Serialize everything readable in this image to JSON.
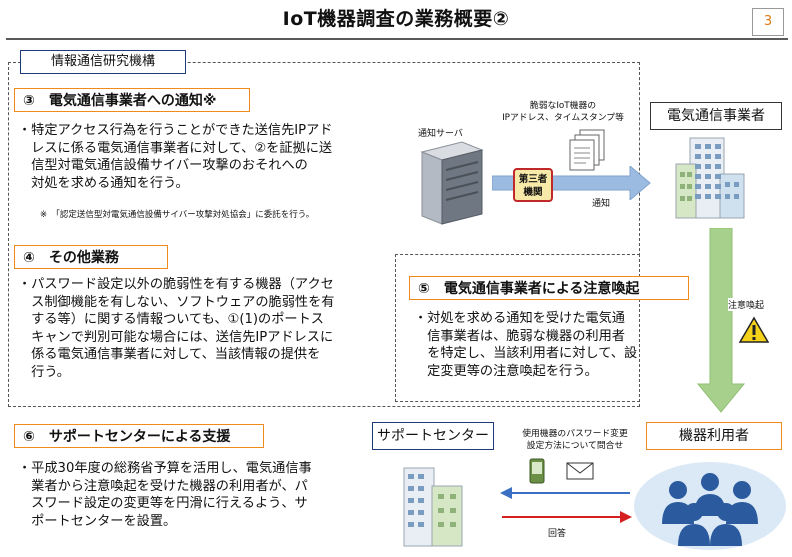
{
  "page": {
    "title": "IoT機器調査の業務概要②",
    "page_number": "3",
    "org_label": "情報通信研究機構"
  },
  "section3": {
    "heading": "③　電気通信事業者への通知※",
    "lines": [
      "・特定アクセス行為を行うことができた送信先IPアド",
      "　レスに係る電気通信事業者に対して、②を証拠に送",
      "　信型対電気通信設備サイバー攻撃のおそれへの",
      "　対処を求める通知を行う。"
    ],
    "note": "※　「認定送信型対電気通信設備サイバー攻撃対処協会」に委託を行う。"
  },
  "section4": {
    "heading": "④　その他業務",
    "lines": [
      "・パスワード設定以外の脆弱性を有する機器（アクセ",
      "　ス制御機能を有しない、ソフトウェアの脆弱性を有",
      "　する等）に関する情報ついても、①(1)のポートス",
      "　キャンで判別可能な場合には、送信先IPアドレスに",
      "　係る電気通信事業者に対して、当該情報の提供を",
      "　行う。"
    ]
  },
  "section5": {
    "heading": "⑤　電気通信事業者による注意喚起",
    "lines": [
      "・対処を求める通知を受けた電気通",
      "　信事業者は、脆弱な機器の利用者",
      "　を特定し、当該利用者に対して、設",
      "　定変更等の注意喚起を行う。"
    ]
  },
  "section6": {
    "heading": "⑥　サポートセンターによる支援",
    "lines": [
      "・平成30年度の総務省予算を活用し、電気通信事",
      "　業者から注意喚起を受けた機器の利用者が、パ",
      "　スワード設定の変更等を円滑に行えるよう、サ",
      "　ポートセンターを設置。"
    ]
  },
  "diagram": {
    "server_label": "通知サーバ",
    "docs_label_line1": "脆弱なIoT機器の",
    "docs_label_line2": "IPアドレス、タイムスタンプ等",
    "third_party_line1": "第三者",
    "third_party_line2": "機関",
    "notify_label": "通知",
    "carrier_label": "電気通信事業者",
    "alert_label": "注意喚起",
    "support_center_label": "サポートセンター",
    "inquiry_line1": "使用機器のパスワード変更",
    "inquiry_line2": "設定方法について問合せ",
    "answer_label": "回答",
    "user_label": "機器利用者",
    "colors": {
      "accent_orange": "#f08a1a",
      "org_blue": "#1f3a7a",
      "arrow_blue": "#9bbbe0",
      "arrow_green": "#a8d08d",
      "third_party_red": "#c0282a",
      "inquiry_arrow": "#3a6fc4",
      "answer_arrow": "#d42020"
    }
  }
}
